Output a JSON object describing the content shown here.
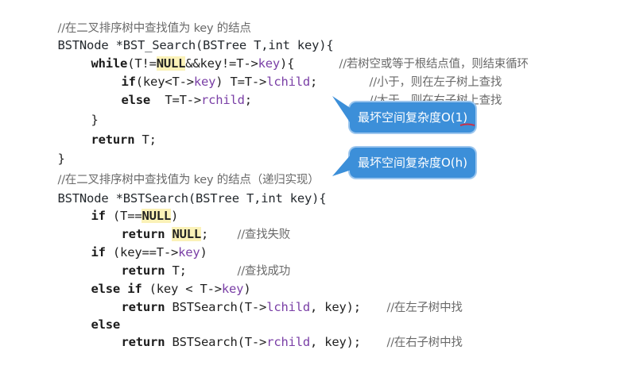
{
  "code_lines": [
    {
      "comment": "//在二叉排序树中查找值为 key 的结点"
    },
    {
      "text": "BSTNode *BST_Search(BSTree T,int key){"
    },
    {
      "kw": "while",
      "text1": "(T!=",
      "hl": "NULL",
      "text2": "&&key!=T->",
      "field": "key",
      "text3": "){",
      "comment": "//若树空或等于根结点值，则结束循环"
    },
    {
      "kw": "if",
      "text1": "(key<T->",
      "field": "key",
      "text2": ") T=T->",
      "field2": "lchild",
      "text3": ";",
      "comment": "//小于，则在左子树上查找"
    },
    {
      "kw": "else",
      "text1": "  T=T->",
      "field": "rchild",
      "text2": ";",
      "comment": "//大于，则在右子树上查找"
    },
    {
      "text": "}"
    },
    {
      "kw": "return",
      "text1": " T;"
    },
    {
      "text": "}"
    },
    {
      "comment": "//在二叉排序树中查找值为 key 的结点（递归实现）"
    },
    {
      "text": "BSTNode *BSTSearch(BSTree T,int key){"
    },
    {
      "kw": "if",
      "text1": " (T==",
      "hl": "NULL",
      "text2": ")"
    },
    {
      "kw": "return",
      "text1": " ",
      "hl": "NULL",
      "text2": ";",
      "comment": "//查找失败"
    },
    {
      "kw": "if",
      "text1": " (key==T->",
      "field": "key",
      "text2": ")"
    },
    {
      "kw": "return",
      "text1": " T;",
      "comment": "//查找成功"
    },
    {
      "kw": "else if",
      "text1": " (key < T->",
      "field": "key",
      "text2": ")"
    },
    {
      "kw": "return",
      "text1": " BSTSearch(T->",
      "field": "lchild",
      "text2": ", key);",
      "comment": "//在左子树中找"
    },
    {
      "kw": "else"
    },
    {
      "kw": "return",
      "text1": " BSTSearch(T->",
      "field": "rchild",
      "text2": ", key);",
      "comment": "//在右子树中找"
    }
  ],
  "callouts": {
    "iterative": "最坏空间复杂度O(1)",
    "recursive": "最坏空间复杂度O(h)"
  },
  "colors": {
    "callout_bg": "#3c8fd9",
    "null_highlight": "#fbf2b8",
    "field_color": "#7a3fa6",
    "underline": "#c8324b"
  }
}
